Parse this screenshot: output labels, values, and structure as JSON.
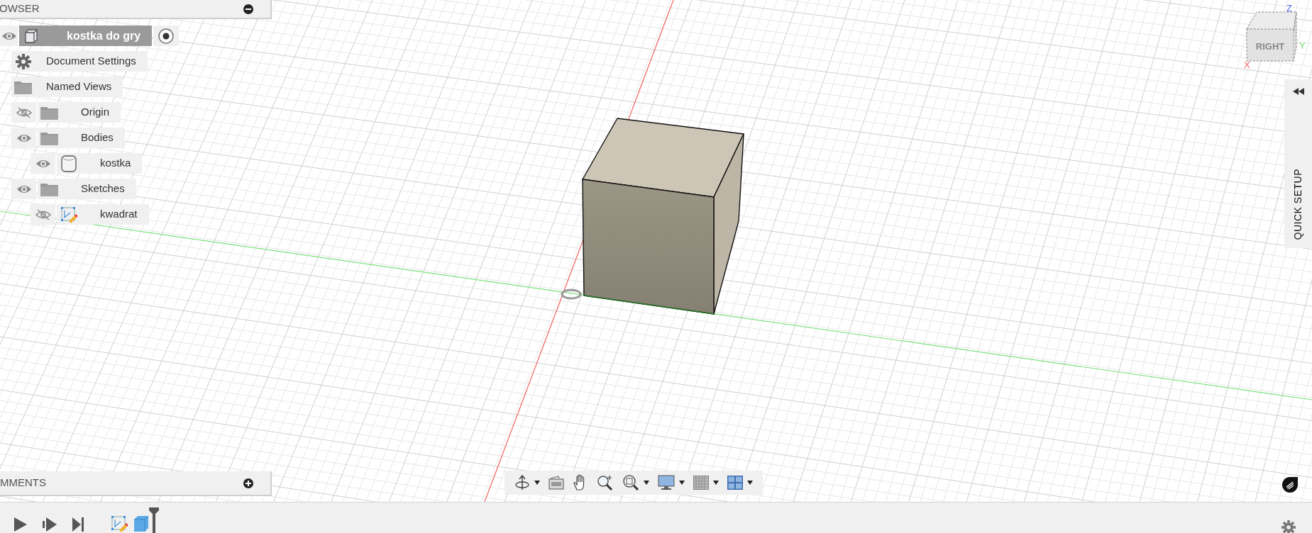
{
  "browser": {
    "title": "OWSER",
    "items": [
      {
        "label": "kostka do gry",
        "kind": "component",
        "visible": true,
        "selected": true,
        "active": true,
        "children": [
          {
            "label": "Document Settings",
            "kind": "settings",
            "selected": false
          },
          {
            "label": "Named Views",
            "kind": "folder",
            "selected": false
          },
          {
            "label": "Origin",
            "kind": "folder",
            "visible": false,
            "selected": false
          },
          {
            "label": "Bodies",
            "kind": "folder",
            "visible": true,
            "selected": false,
            "children": [
              {
                "label": "kostka",
                "kind": "body",
                "visible": true,
                "selected": false
              }
            ]
          },
          {
            "label": "Sketches",
            "kind": "folder",
            "visible": true,
            "selected": false,
            "children": [
              {
                "label": "kwadrat",
                "kind": "sketch",
                "visible": false,
                "selected": false
              }
            ]
          }
        ]
      }
    ]
  },
  "view_cube": {
    "face": "RIGHT",
    "axes": [
      "Z",
      "Y",
      "X"
    ]
  },
  "quick_setup": {
    "label": "QUICK SETUP"
  },
  "comments": {
    "title": "MMENTS"
  },
  "nav_toolbar": [
    {
      "kind": "orbit",
      "menu": true
    },
    {
      "kind": "look_at",
      "menu": false
    },
    {
      "kind": "pan",
      "menu": false
    },
    {
      "kind": "zoom",
      "menu": false
    },
    {
      "kind": "fit",
      "menu": true
    },
    {
      "kind": "display",
      "menu": true
    },
    {
      "kind": "grid",
      "menu": true
    },
    {
      "kind": "viewports",
      "menu": true
    }
  ],
  "timeline": {
    "controls": [
      {
        "kind": "play"
      },
      {
        "kind": "step"
      },
      {
        "kind": "end"
      }
    ],
    "features": [
      {
        "kind": "sketch"
      },
      {
        "kind": "extrude"
      }
    ]
  }
}
